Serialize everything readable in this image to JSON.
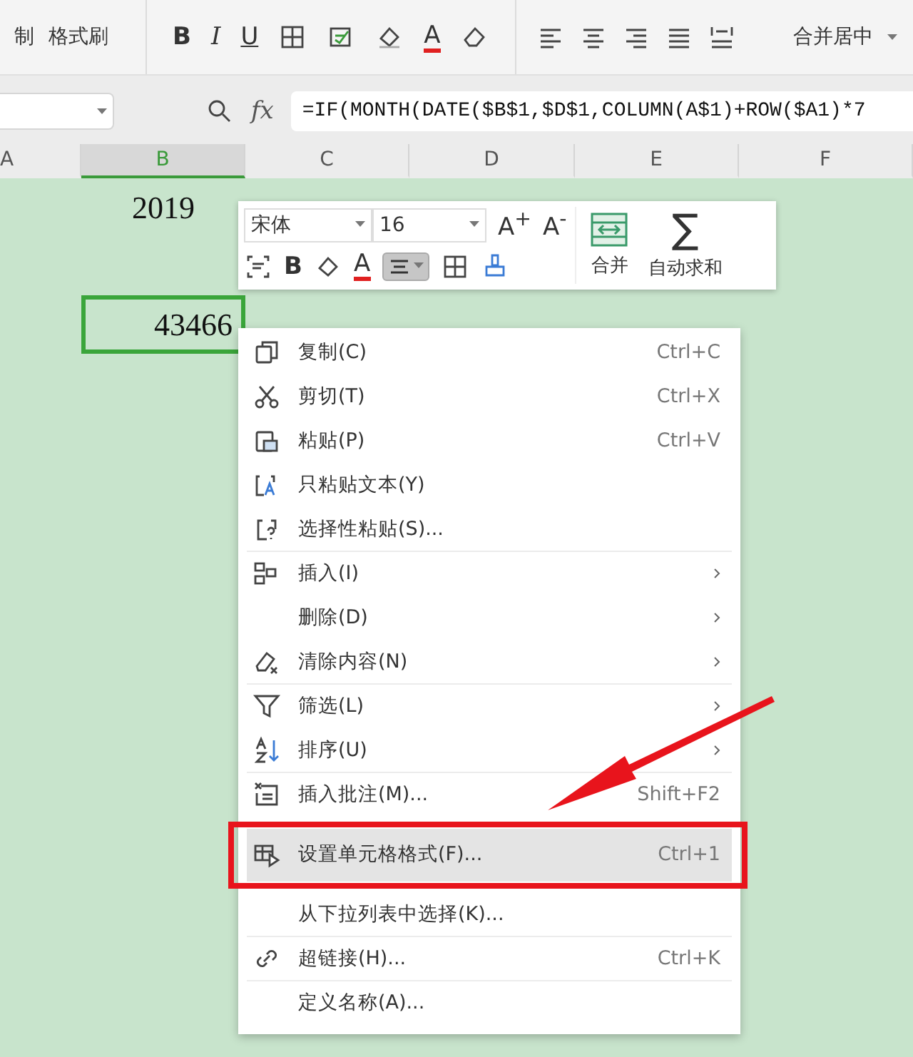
{
  "ribbon": {
    "left_labels": [
      "制",
      "格式刷"
    ],
    "bold": "B",
    "italic": "I",
    "underline": "U",
    "font_color": "A",
    "merge_center": "合并居中"
  },
  "formula_bar": {
    "fx": "fx",
    "formula": "=IF(MONTH(DATE($B$1,$D$1,COLUMN(A$1)+ROW($A1)*7"
  },
  "sheet": {
    "columns": [
      {
        "label": "A",
        "selected": false
      },
      {
        "label": "B",
        "selected": true
      },
      {
        "label": "C",
        "selected": false
      },
      {
        "label": "D",
        "selected": false
      },
      {
        "label": "E",
        "selected": false
      },
      {
        "label": "F",
        "selected": false
      }
    ],
    "rows": [
      {
        "cells": [
          {
            "text": "2019",
            "selected": false
          }
        ]
      },
      {
        "cells": [
          {
            "text": "43466",
            "selected": true
          }
        ]
      }
    ]
  },
  "mini_toolbar": {
    "font": "宋体",
    "size": "16",
    "grow": "A$^{+}$",
    "shrink": "A$^{-}$",
    "bold": "B",
    "font_color": "A",
    "center_selected": true,
    "merge": "合并",
    "autosum_symbol": "∑",
    "autosum": "自动求和"
  },
  "context_menu": [
    {
      "label": "复制(C)",
      "shortcut": "Ctrl+C",
      "submenu": false,
      "group_end": false,
      "selected": false
    },
    {
      "label": "剪切(T)",
      "shortcut": "Ctrl+X",
      "submenu": false,
      "group_end": false,
      "selected": false
    },
    {
      "label": "粘贴(P)",
      "shortcut": "Ctrl+V",
      "submenu": false,
      "group_end": false,
      "selected": false
    },
    {
      "label": "只粘贴文本(Y)",
      "submenu": false,
      "group_end": false,
      "selected": false
    },
    {
      "label": "选择性粘贴(S)...",
      "submenu": false,
      "group_end": true,
      "selected": false
    },
    {
      "label": "插入(I)",
      "submenu": true,
      "group_end": false,
      "selected": false
    },
    {
      "label": "删除(D)",
      "submenu": true,
      "group_end": false,
      "selected": false
    },
    {
      "label": "清除内容(N)",
      "submenu": true,
      "group_end": true,
      "selected": false
    },
    {
      "label": "筛选(L)",
      "submenu": true,
      "group_end": false,
      "selected": false
    },
    {
      "label": "排序(U)",
      "submenu": true,
      "group_end": true,
      "selected": false
    },
    {
      "label": "插入批注(M)...",
      "shortcut": "Shift+F2",
      "submenu": false,
      "group_end": false,
      "selected": false
    },
    {
      "label": "设置单元格格式(F)...",
      "shortcut": "Ctrl+1",
      "submenu": false,
      "group_end": false,
      "selected": true
    },
    {
      "label": "从下拉列表中选择(K)...",
      "submenu": false,
      "group_end": true,
      "selected": false
    },
    {
      "label": "超链接(H)...",
      "shortcut": "Ctrl+K",
      "submenu": false,
      "group_end": true,
      "selected": false
    },
    {
      "label": "定义名称(A)...",
      "submenu": false,
      "group_end": false,
      "selected": false
    }
  ],
  "annotation": {
    "highlight_item": true
  }
}
